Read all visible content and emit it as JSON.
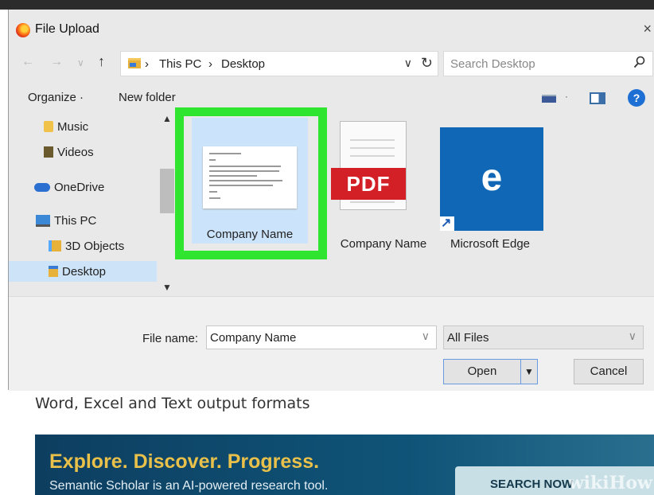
{
  "dialog": {
    "title": "File Upload",
    "close": "×",
    "nav": {
      "back": "←",
      "forward": "→",
      "recent": "∨",
      "up": "↑"
    },
    "address": {
      "sep1": "›",
      "crumb1": "This PC",
      "sep2": "›",
      "crumb2": "Desktop",
      "dropdown": "∨",
      "refresh": "↻"
    },
    "search": {
      "placeholder": "Search Desktop",
      "icon": "search-icon"
    },
    "toolbar": {
      "organize": "Organize ·",
      "new_folder": "New folder",
      "view_dd": "·",
      "help": "?"
    },
    "sidebar": {
      "items": [
        {
          "label": "Music",
          "icon": "music-folder-icon"
        },
        {
          "label": "Videos",
          "icon": "videos-folder-icon"
        },
        {
          "label": "OneDrive",
          "icon": "onedrive-icon"
        },
        {
          "label": "This PC",
          "icon": "this-pc-icon"
        },
        {
          "label": "3D Objects",
          "icon": "3d-objects-icon"
        },
        {
          "label": "Desktop",
          "icon": "desktop-folder-icon",
          "selected": true
        }
      ],
      "scroll_up": "▲",
      "scroll_down": "▼"
    },
    "files": [
      {
        "label": "Company Name",
        "type": "word-document",
        "selected": true
      },
      {
        "label": "Company Name",
        "type": "pdf",
        "badge": "PDF"
      },
      {
        "label": "Microsoft Edge",
        "type": "shortcut",
        "glyph": "e"
      }
    ],
    "file_name_label": "File name:",
    "file_name_value": "Company Name",
    "filter_value": "All Files",
    "dropdown_glyph": "∨",
    "open_label": "Open",
    "open_dropdown": "▼",
    "cancel_label": "Cancel"
  },
  "page": {
    "formats_text": "Word, Excel and Text output formats",
    "banner_title": "Explore. Discover. Progress.",
    "banner_sub": "Semantic Scholar is an AI-powered research tool.",
    "banner_button": "SEARCH NOW",
    "watermark": "wikiHow"
  },
  "colors": {
    "highlight": "#30e530",
    "pdf_red": "#d31f26",
    "edge_blue": "#1067b6",
    "selection": "#cce4fb"
  }
}
